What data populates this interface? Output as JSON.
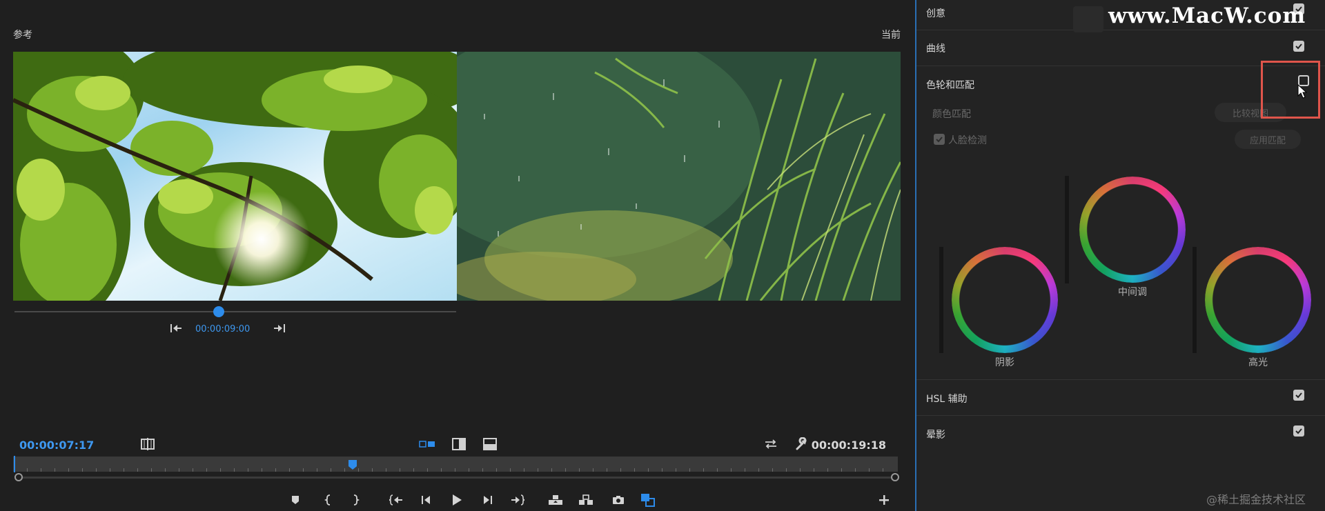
{
  "monitor": {
    "reference_label": "参考",
    "current_label": "当前",
    "reference_time": "00:00:09:00",
    "current_time": "00:00:07:17",
    "duration": "00:00:19:18",
    "playhead_fraction": 0.3
  },
  "panel": {
    "sections": [
      {
        "label": "创意",
        "checked": true
      },
      {
        "label": "曲线",
        "checked": true
      },
      {
        "label": "色轮和匹配",
        "checked": false
      },
      {
        "label": "HSL 辅助",
        "checked": true
      },
      {
        "label": "晕影",
        "checked": true
      }
    ],
    "color_match_label": "颜色匹配",
    "compare_view_button": "比较视图",
    "face_detect_label": "人脸检测",
    "apply_match_button": "应用匹配",
    "wheels": {
      "midtones": "中间调",
      "shadows": "阴影",
      "highlights": "高光"
    }
  },
  "overlay": {
    "watermark": "www.MacW.com",
    "source_credit": "@稀土掘金技术社区"
  },
  "colors": {
    "accent_blue": "#2d8ceb",
    "highlight_red": "#e0554b",
    "panel_bg": "#232323",
    "monitor_bg": "#1f1f1f"
  },
  "icons": [
    "step-back-icon",
    "step-forward-icon",
    "marker-icon",
    "in-point-icon",
    "out-point-icon",
    "go-to-in-icon",
    "step-back-frame-icon",
    "play-icon",
    "step-forward-frame-icon",
    "go-to-out-icon",
    "lift-icon",
    "extract-icon",
    "camera-icon",
    "comparison-view-icon",
    "add-icon",
    "swap-icon",
    "wrench-icon",
    "side-by-side-icon",
    "vertical-split-icon",
    "horizontal-split-icon",
    "shot-or-frame-icon"
  ]
}
